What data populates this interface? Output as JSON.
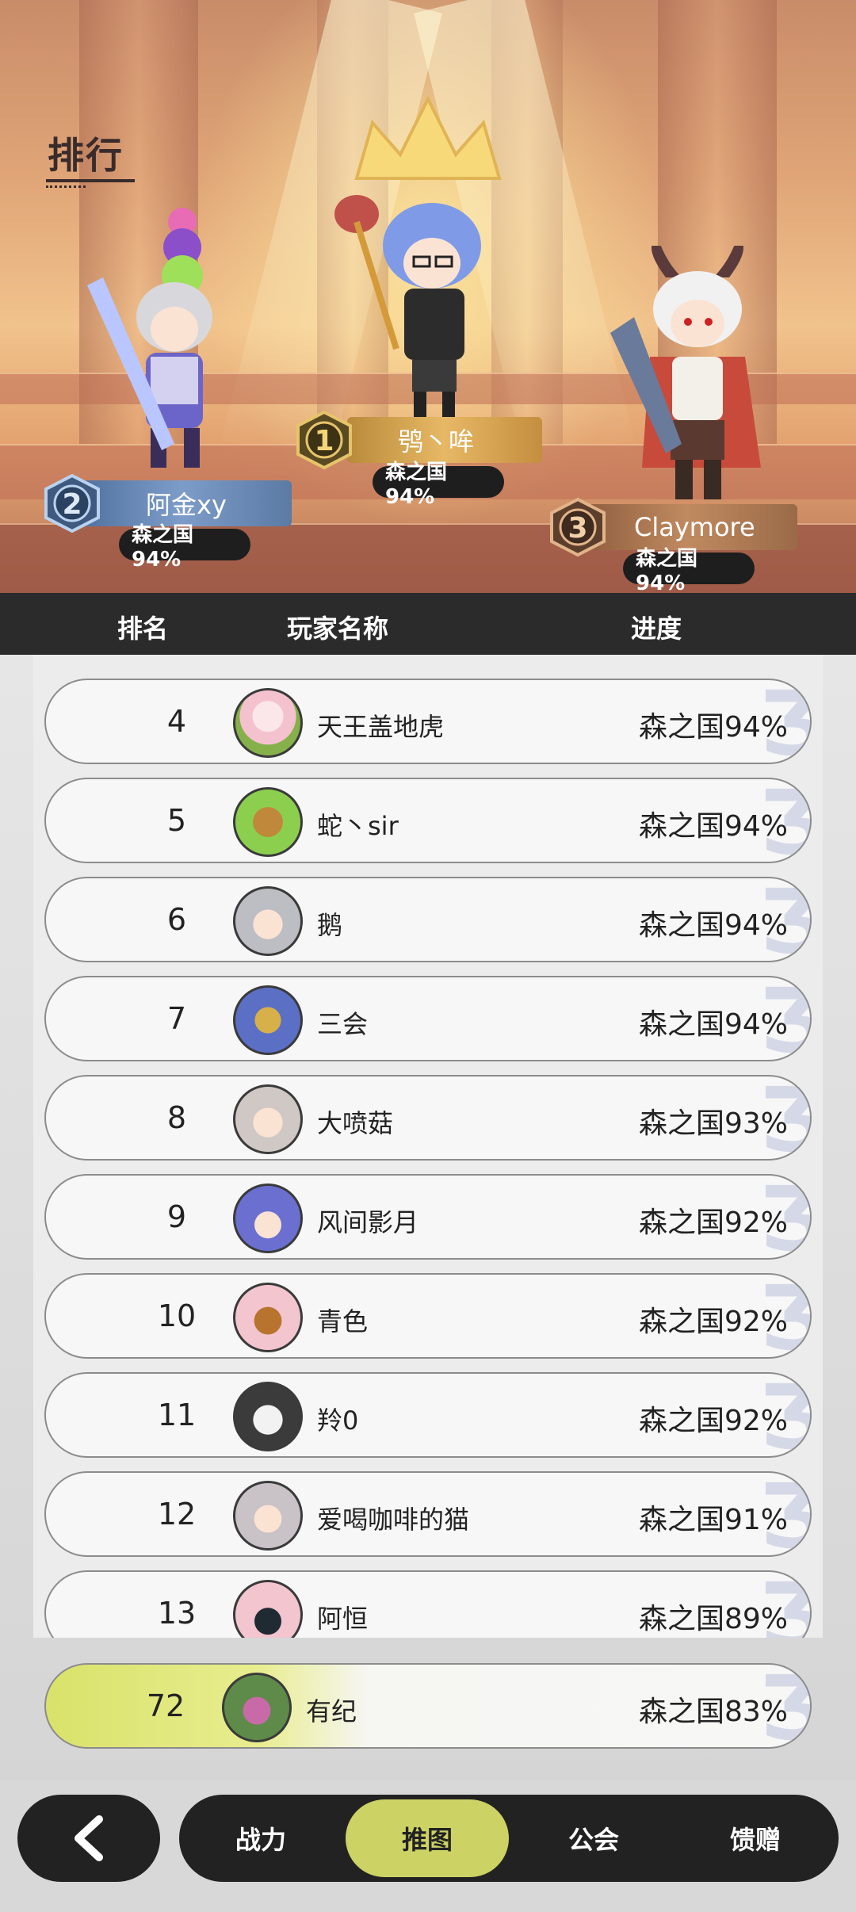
{
  "header": {
    "title": "排行"
  },
  "podium": [
    {
      "rank": "1",
      "name": "鸮丶哞",
      "progress": "森之国94%"
    },
    {
      "rank": "2",
      "name": "阿金xy",
      "progress": "森之国94%"
    },
    {
      "rank": "3",
      "name": "Claymore",
      "progress": "森之国94%"
    }
  ],
  "columns": {
    "rank": "排名",
    "player": "玩家名称",
    "progress": "进度"
  },
  "rows": [
    {
      "rank": "4",
      "name": "天王盖地虎",
      "progress": "森之国94%"
    },
    {
      "rank": "5",
      "name": "蛇丶sir",
      "progress": "森之国94%"
    },
    {
      "rank": "6",
      "name": "鹅",
      "progress": "森之国94%"
    },
    {
      "rank": "7",
      "name": "三会",
      "progress": "森之国94%"
    },
    {
      "rank": "8",
      "name": "大喷菇",
      "progress": "森之国93%"
    },
    {
      "rank": "9",
      "name": "风间影月",
      "progress": "森之国92%"
    },
    {
      "rank": "10",
      "name": "青色",
      "progress": "森之国92%"
    },
    {
      "rank": "11",
      "name": "羚0",
      "progress": "森之国92%"
    },
    {
      "rank": "12",
      "name": "爱喝咖啡的猫",
      "progress": "森之国91%"
    },
    {
      "rank": "13",
      "name": "阿恒",
      "progress": "森之国89%"
    }
  ],
  "self": {
    "rank": "72",
    "name": "有纪",
    "progress": "森之国83%"
  },
  "nav": {
    "tabs": [
      {
        "label": "战力"
      },
      {
        "label": "推图"
      },
      {
        "label": "公会"
      },
      {
        "label": "馈赠"
      }
    ],
    "active_index": 1
  },
  "colors": {
    "accent": "#cdd264",
    "dark": "#222222"
  }
}
